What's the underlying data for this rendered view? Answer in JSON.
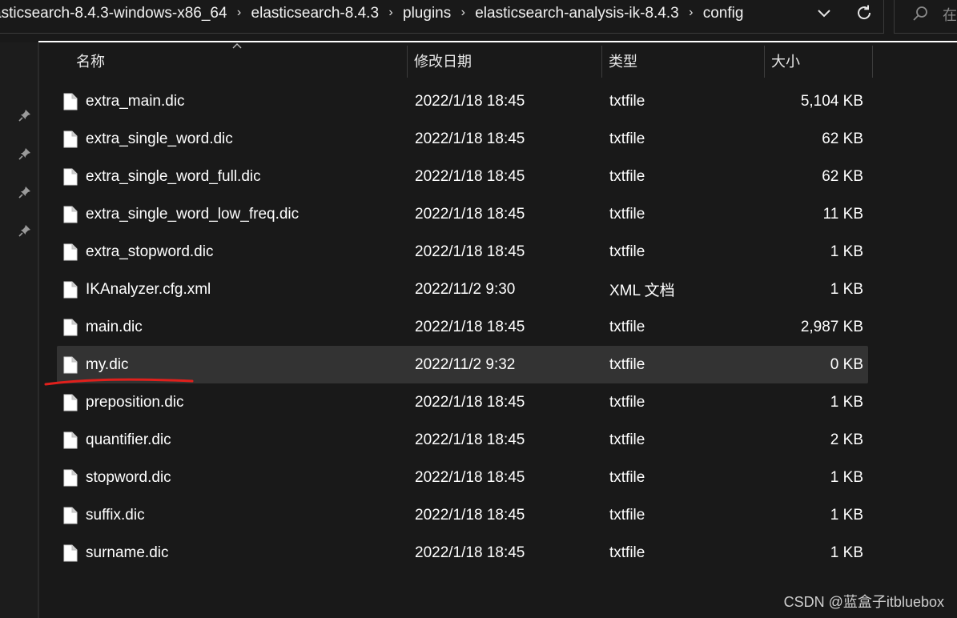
{
  "address_bar": {
    "crumbs": [
      "asticsearch-8.4.3-windows-x86_64",
      "elasticsearch-8.4.3",
      "plugins",
      "elasticsearch-analysis-ik-8.4.3",
      "config"
    ],
    "separator": "›",
    "search_placeholder": "在"
  },
  "columns": {
    "name": "名称",
    "modified": "修改日期",
    "type": "类型",
    "size": "大小"
  },
  "files": [
    {
      "name": "extra_main.dic",
      "modified": "2022/1/18 18:45",
      "type": "txtfile",
      "size": "5,104 KB"
    },
    {
      "name": "extra_single_word.dic",
      "modified": "2022/1/18 18:45",
      "type": "txtfile",
      "size": "62 KB"
    },
    {
      "name": "extra_single_word_full.dic",
      "modified": "2022/1/18 18:45",
      "type": "txtfile",
      "size": "62 KB"
    },
    {
      "name": "extra_single_word_low_freq.dic",
      "modified": "2022/1/18 18:45",
      "type": "txtfile",
      "size": "11 KB"
    },
    {
      "name": "extra_stopword.dic",
      "modified": "2022/1/18 18:45",
      "type": "txtfile",
      "size": "1 KB"
    },
    {
      "name": "IKAnalyzer.cfg.xml",
      "modified": "2022/11/2 9:30",
      "type": "XML 文档",
      "size": "1 KB"
    },
    {
      "name": "main.dic",
      "modified": "2022/1/18 18:45",
      "type": "txtfile",
      "size": "2,987 KB"
    },
    {
      "name": "my.dic",
      "modified": "2022/11/2 9:32",
      "type": "txtfile",
      "size": "0 KB",
      "selected": true
    },
    {
      "name": "preposition.dic",
      "modified": "2022/1/18 18:45",
      "type": "txtfile",
      "size": "1 KB"
    },
    {
      "name": "quantifier.dic",
      "modified": "2022/1/18 18:45",
      "type": "txtfile",
      "size": "2 KB"
    },
    {
      "name": "stopword.dic",
      "modified": "2022/1/18 18:45",
      "type": "txtfile",
      "size": "1 KB"
    },
    {
      "name": "suffix.dic",
      "modified": "2022/1/18 18:45",
      "type": "txtfile",
      "size": "1 KB"
    },
    {
      "name": "surname.dic",
      "modified": "2022/1/18 18:45",
      "type": "txtfile",
      "size": "1 KB"
    }
  ],
  "watermark": "CSDN @蓝盒子itbluebox",
  "colors": {
    "background": "#191919",
    "selected_row": "#333333",
    "annotation_underline": "#e0201c"
  },
  "icons": {
    "file": "document-icon",
    "pin": "pin-icon",
    "refresh": "refresh-icon",
    "dropdown": "chevron-down-icon",
    "search": "search-icon"
  }
}
